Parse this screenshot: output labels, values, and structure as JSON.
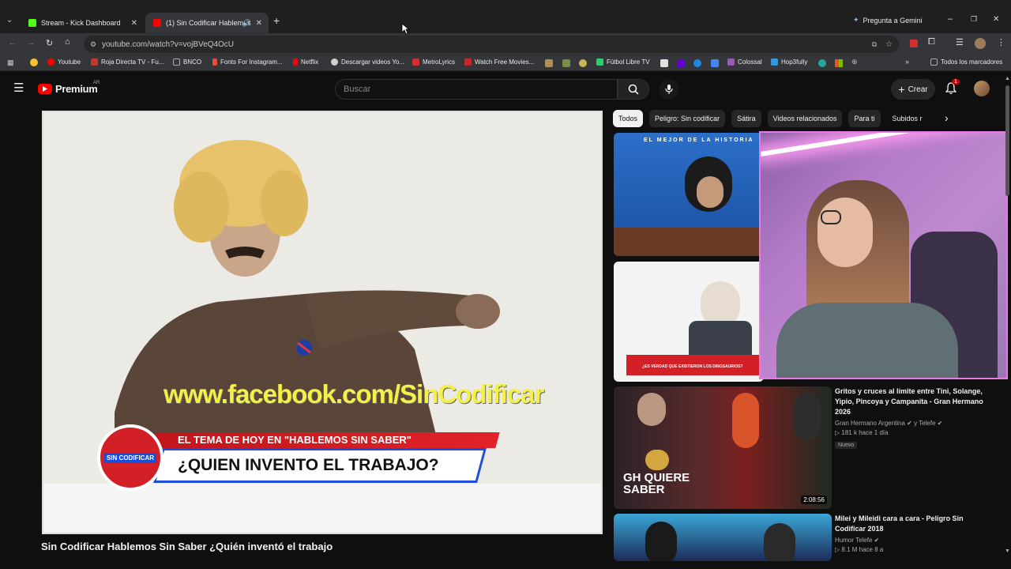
{
  "browser": {
    "tabs": [
      {
        "label": "Stream - Kick Dashboard",
        "color": "#53fc18"
      },
      {
        "label": "(1) Sin Codificar Hablemos",
        "color": "#ff0000"
      }
    ],
    "gemini_label": "Pregunta a Gemini",
    "url": "youtube.com/watch?v=vojBVeQ4OcU",
    "bookmarks": [
      {
        "label": "Youtube",
        "color": "#ff0000"
      },
      {
        "label": "Roja Directa TV - Fu...",
        "color": "#c0392b"
      },
      {
        "label": "BNCO",
        "color": "#888888"
      },
      {
        "label": "Fonts For Instagram...",
        "color": "#e74c3c"
      },
      {
        "label": "Netflix",
        "color": "#e50914"
      },
      {
        "label": "Descargar videos Yo...",
        "color": "#d0d0d0"
      },
      {
        "label": "MetroLyrics",
        "color": "#d32f2f"
      },
      {
        "label": "Watch Free Movies...",
        "color": "#c62828"
      },
      {
        "label": "Fútbol Libre TV",
        "color": "#2ecc71"
      },
      {
        "label": "Colossal",
        "color": "#9b59b6"
      },
      {
        "label": "Hop3fully",
        "color": "#3498db"
      }
    ],
    "all_bookmarks_label": "Todos los marcadores"
  },
  "youtube": {
    "logo_text": "Premium",
    "logo_region": "AR",
    "search_placeholder": "Buscar",
    "create_label": "Crear",
    "notification_count": "1",
    "video_title": "Sin Codificar Hablemos Sin Saber ¿Quién inventó el trabajo",
    "video_overlay": {
      "url_text": "www.facebook.com/SinCodificar",
      "banner_top": "EL TEMA DE HOY EN \"HABLEMOS SIN SABER\"",
      "banner_main": "¿QUIEN INVENTO EL TRABAJO?",
      "logo_text": "SIN CODIFICAR"
    },
    "chips": [
      "Todos",
      "Peligro: Sin codificar",
      "Sátira",
      "Videos relacionados",
      "Para ti",
      "Subidos r"
    ],
    "recommendations": [
      {
        "thumb_text": "EL MEJOR DE LA HISTORIA",
        "title": "",
        "channel": ""
      },
      {
        "thumb_text": "¿ES VERDAD QUE EXISTIERON LOS DINOSAURIOS?",
        "title": "",
        "channel": ""
      },
      {
        "thumb_text": "GH QUIERE SABER",
        "title": "Gritos y cruces al límite entre Tini, Solange, Yipio, Pincoya y Campanita - Gran Hermano 2026",
        "channel": "Gran Hermano Argentina",
        "channel_extra": "y Telefe",
        "views": "181 k",
        "age": "hace 1 día",
        "badge": "Nuevo",
        "duration": "2:08:56"
      },
      {
        "thumb_text": "",
        "title": "Milei y Mileidi cara a cara - Peligro Sin Codificar 2018",
        "channel": "Humor Telefe",
        "views": "8.1 M",
        "age": "hace 8 a"
      }
    ]
  }
}
